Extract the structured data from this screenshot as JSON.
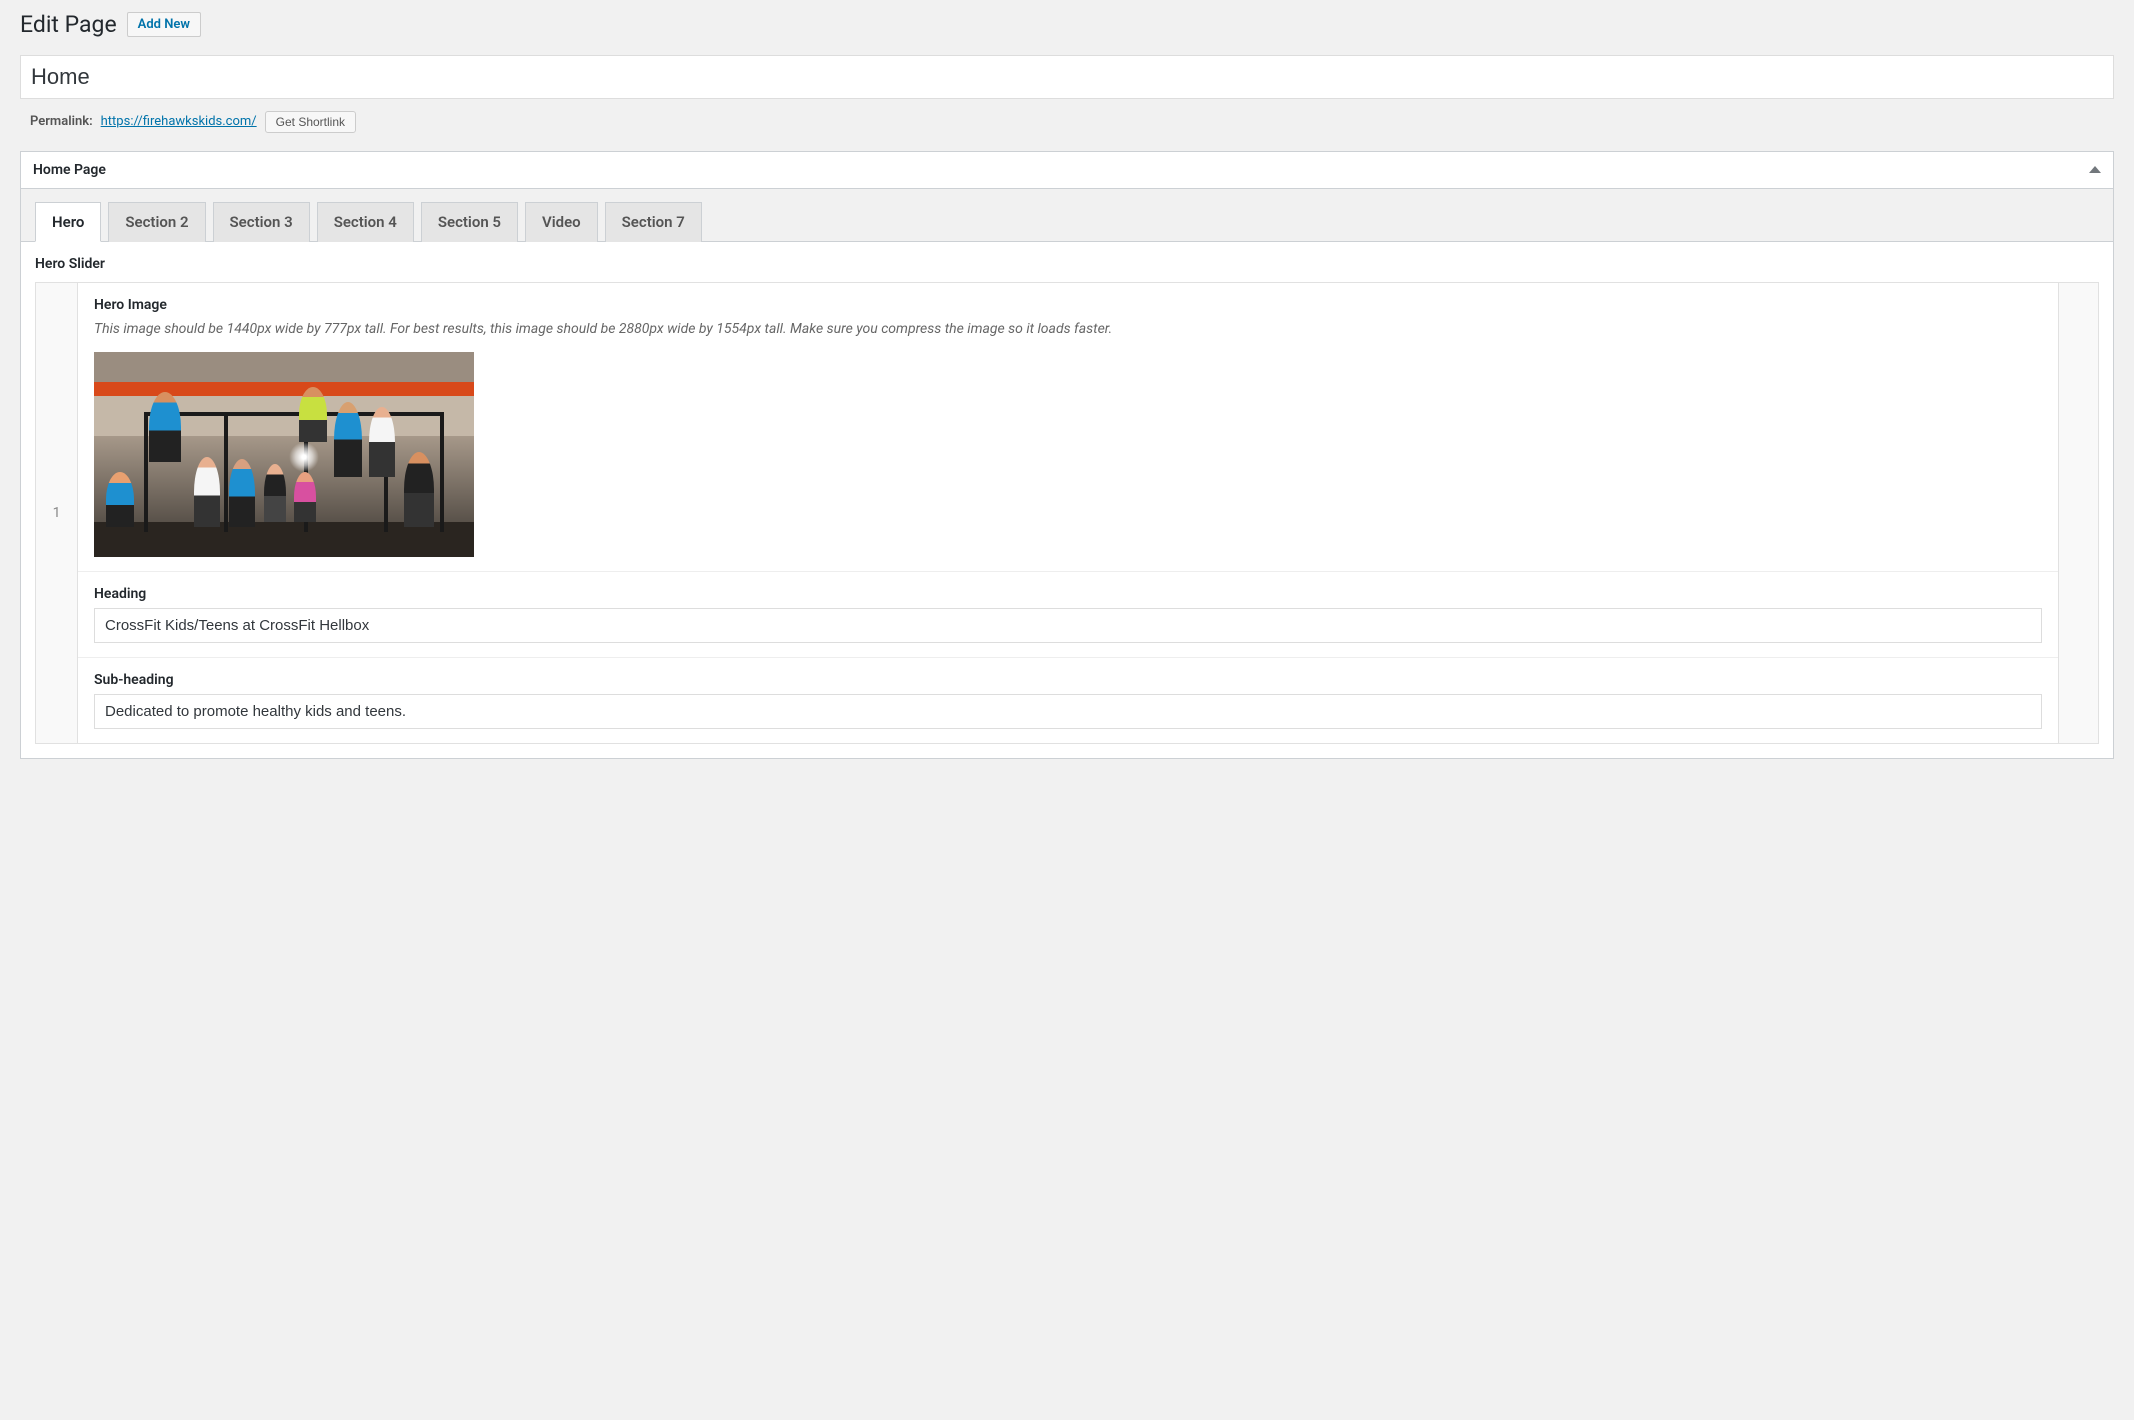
{
  "header": {
    "page_title": "Edit Page",
    "add_new_label": "Add New"
  },
  "title_input_value": "Home",
  "permalink": {
    "label": "Permalink:",
    "url": "https://firehawkskids.com/",
    "shortlink_label": "Get Shortlink"
  },
  "postbox": {
    "title": "Home Page"
  },
  "tabs": [
    {
      "label": "Hero",
      "active": true
    },
    {
      "label": "Section 2",
      "active": false
    },
    {
      "label": "Section 3",
      "active": false
    },
    {
      "label": "Section 4",
      "active": false
    },
    {
      "label": "Section 5",
      "active": false
    },
    {
      "label": "Video",
      "active": false
    },
    {
      "label": "Section 7",
      "active": false
    }
  ],
  "hero_slider": {
    "section_label": "Hero Slider",
    "row_number": "1",
    "fields": {
      "hero_image": {
        "label": "Hero Image",
        "description": "This image should be 1440px wide by 777px tall. For best results, this image should be 2880px wide by 1554px tall. Make sure you compress the image so it loads faster."
      },
      "heading": {
        "label": "Heading",
        "value": "CrossFit Kids/Teens at CrossFit Hellbox"
      },
      "subheading": {
        "label": "Sub-heading",
        "value": "Dedicated to promote healthy kids and teens."
      }
    }
  }
}
